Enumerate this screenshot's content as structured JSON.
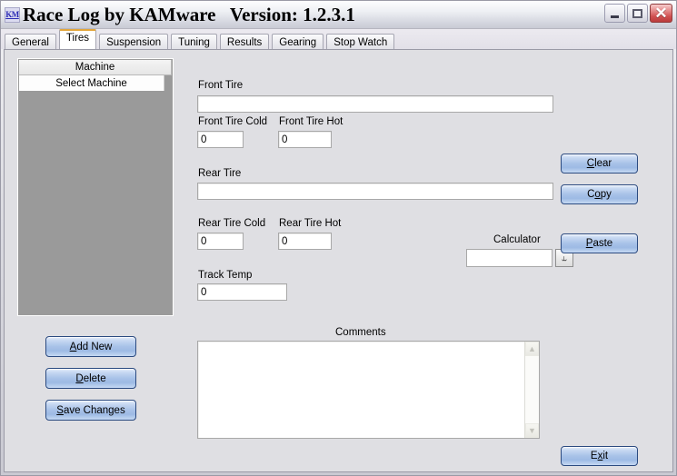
{
  "window": {
    "title": "Race Log by KAMware   Version: 1.2.3.1",
    "icon_label": "KM",
    "icon_name": "km-logo-icon",
    "controls": {
      "minimize": "minimize-icon",
      "maximize": "maximize-icon",
      "close": "✕"
    }
  },
  "tabs": [
    {
      "label": "General",
      "selected": false
    },
    {
      "label": "Tires",
      "selected": true
    },
    {
      "label": "Suspension",
      "selected": false
    },
    {
      "label": "Tuning",
      "selected": false
    },
    {
      "label": "Results",
      "selected": false
    },
    {
      "label": "Gearing",
      "selected": false
    },
    {
      "label": "Stop Watch",
      "selected": false
    }
  ],
  "machine_list": {
    "header": "Machine",
    "rows": [
      "Select Machine"
    ]
  },
  "left_buttons": {
    "add_new": {
      "pre": "A",
      "accel": "",
      "rest": "dd New",
      "label": "Add New"
    },
    "delete": {
      "label": "Delete"
    },
    "save_changes": {
      "label": "Save Changes"
    }
  },
  "form": {
    "front_tire": {
      "label": "Front Tire",
      "value": "",
      "placeholder": ""
    },
    "front_tire_cold": {
      "label": "Front Tire Cold",
      "value": "0"
    },
    "front_tire_hot": {
      "label": "Front Tire Hot",
      "value": "0"
    },
    "rear_tire": {
      "label": "Rear Tire",
      "value": "",
      "placeholder": ""
    },
    "rear_tire_cold": {
      "label": "Rear Tire Cold",
      "value": "0"
    },
    "rear_tire_hot": {
      "label": "Rear Tire Hot",
      "value": "0"
    },
    "track_temp": {
      "label": "Track Temp",
      "value": "0"
    },
    "calculator": {
      "label": "Calculator",
      "value": ""
    },
    "comments": {
      "label": "Comments",
      "value": ""
    }
  },
  "right_buttons": {
    "clear": "Clear",
    "copy": "Copy",
    "paste": "Paste",
    "exit": "Exit"
  },
  "colors": {
    "button_border": "#2b4a80",
    "button_face": "#a8c2e8",
    "selected_tab_accent": "#e3a63b",
    "client_bg": "#dfdfe3",
    "listbox_bg": "#9a9a9a",
    "close_button": "#cf4f4f"
  }
}
